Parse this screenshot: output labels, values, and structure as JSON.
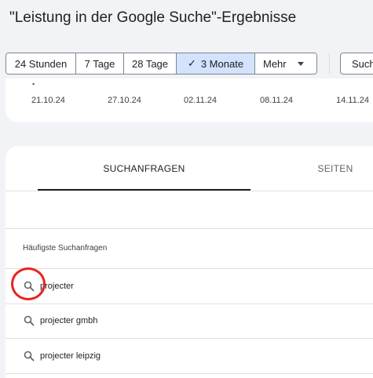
{
  "header": {
    "title": "\"Leistung in der Google Suche\"-Ergebnisse"
  },
  "date_range": {
    "options": [
      "24 Stunden",
      "7 Tage",
      "28 Tage",
      "3 Monate"
    ],
    "selected": "3 Monate",
    "more_label": "Mehr"
  },
  "search_type": {
    "label": "Such"
  },
  "chart": {
    "x_labels": [
      "21.10.24",
      "27.10.24",
      "02.11.24",
      "08.11.24",
      "14.11.24"
    ]
  },
  "tabs": {
    "queries": "SUCHANFRAGEN",
    "pages": "SEITEN"
  },
  "table": {
    "column_header": "Häufigste Suchanfragen",
    "rows": [
      "projecter",
      "projecter gmbh",
      "projecter leipzig"
    ]
  },
  "colors": {
    "accent_selected": "#d3e3fd",
    "highlight": "#e8231f"
  }
}
